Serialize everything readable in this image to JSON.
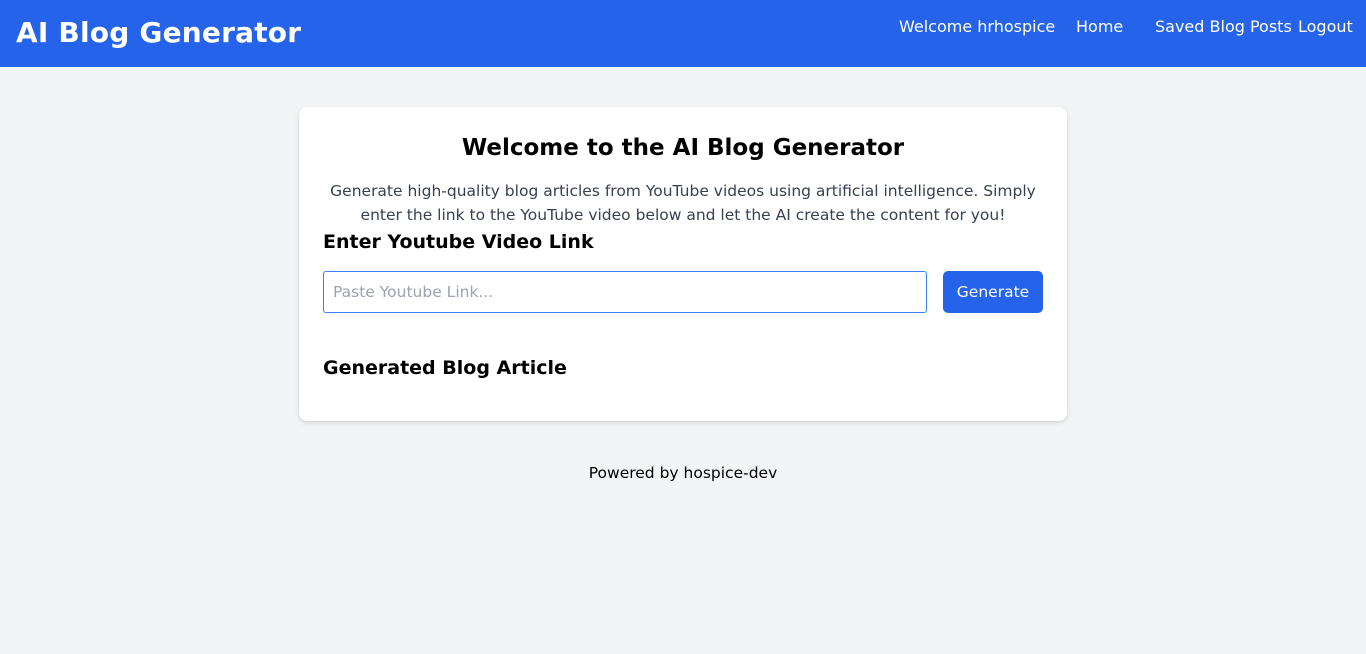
{
  "header": {
    "brand": "AI Blog Generator",
    "nav": {
      "welcome": "Welcome hrhospice",
      "home": "Home",
      "saved": "Saved Blog Posts",
      "logout": "Logout"
    }
  },
  "main": {
    "title": "Welcome to the AI Blog Generator",
    "description": "Generate high-quality blog articles from YouTube videos using artificial intelligence. Simply enter the link to the YouTube video below and let the AI create the content for you!",
    "link_label": "Enter Youtube Video Link",
    "link_input": {
      "value": "",
      "placeholder": "Paste Youtube Link..."
    },
    "generate_label": "Generate",
    "article_label": "Generated Blog Article"
  },
  "footer": {
    "text": "Powered by hospice-dev"
  },
  "colors": {
    "primary": "#2563eb",
    "background": "#f3f4f6",
    "card": "#ffffff"
  }
}
